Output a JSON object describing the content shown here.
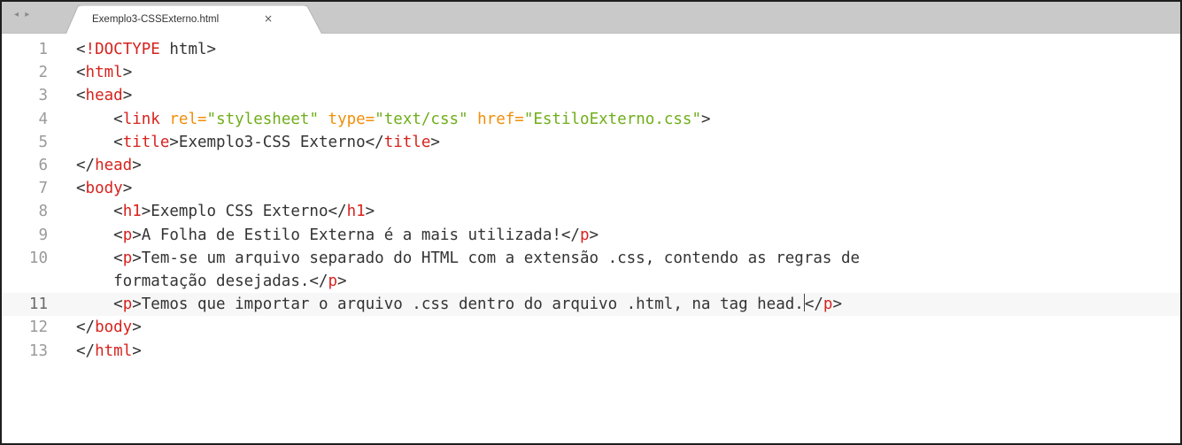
{
  "tabbar": {
    "nav_arrows": "◂ ▸",
    "active_tab": {
      "label": "Exemplo3-CSSExterno.html",
      "close": "×"
    }
  },
  "colors": {
    "tag": "#d6231e",
    "attribute": "#f18f0b",
    "string": "#6fae1a",
    "text": "#333333",
    "line_number": "#9a9a9a",
    "tabbar_bg": "#c9c9c9"
  },
  "editor": {
    "active_line": "11",
    "lines": [
      {
        "num": "1",
        "parts": [
          [
            "t",
            "<"
          ],
          [
            "k",
            "!DOCTYPE"
          ],
          [
            "t",
            " html>"
          ]
        ]
      },
      {
        "num": "2",
        "parts": [
          [
            "t",
            "<"
          ],
          [
            "k",
            "html"
          ],
          [
            "t",
            ">"
          ]
        ]
      },
      {
        "num": "3",
        "parts": [
          [
            "t",
            "<"
          ],
          [
            "k",
            "head"
          ],
          [
            "t",
            ">"
          ]
        ]
      },
      {
        "num": "4",
        "parts": [
          [
            "t",
            "    <"
          ],
          [
            "k",
            "link"
          ],
          [
            "t",
            " "
          ],
          [
            "a",
            "rel="
          ],
          [
            "s",
            "\"stylesheet\""
          ],
          [
            "t",
            " "
          ],
          [
            "a",
            "type="
          ],
          [
            "s",
            "\"text/css\""
          ],
          [
            "t",
            " "
          ],
          [
            "a",
            "href="
          ],
          [
            "s",
            "\"EstiloExterno.css\""
          ],
          [
            "t",
            ">"
          ]
        ]
      },
      {
        "num": "5",
        "parts": [
          [
            "t",
            "    <"
          ],
          [
            "k",
            "title"
          ],
          [
            "t",
            ">Exemplo3-CSS Externo</"
          ],
          [
            "k",
            "title"
          ],
          [
            "t",
            ">"
          ]
        ]
      },
      {
        "num": "6",
        "parts": [
          [
            "t",
            "</"
          ],
          [
            "k",
            "head"
          ],
          [
            "t",
            ">"
          ]
        ]
      },
      {
        "num": "7",
        "parts": [
          [
            "t",
            "<"
          ],
          [
            "k",
            "body"
          ],
          [
            "t",
            ">"
          ]
        ]
      },
      {
        "num": "8",
        "parts": [
          [
            "t",
            "    <"
          ],
          [
            "k",
            "h1"
          ],
          [
            "t",
            ">Exemplo CSS Externo</"
          ],
          [
            "k",
            "h1"
          ],
          [
            "t",
            ">"
          ]
        ]
      },
      {
        "num": "9",
        "parts": [
          [
            "t",
            "    <"
          ],
          [
            "k",
            "p"
          ],
          [
            "t",
            ">A Folha de Estilo Externa é a mais utilizada!</"
          ],
          [
            "k",
            "p"
          ],
          [
            "t",
            ">"
          ]
        ]
      },
      {
        "num": "10",
        "parts": [
          [
            "t",
            "    <"
          ],
          [
            "k",
            "p"
          ],
          [
            "t",
            ">Tem-se um arquivo separado do HTML com a extensão .css, contendo as regras de"
          ]
        ]
      },
      {
        "num": "",
        "parts": [
          [
            "t",
            "    formatação desejadas.</"
          ],
          [
            "k",
            "p"
          ],
          [
            "t",
            ">"
          ]
        ]
      },
      {
        "num": "11",
        "parts": [
          [
            "t",
            "    <"
          ],
          [
            "k",
            "p"
          ],
          [
            "t",
            ">Temos que importar o arquivo .css dentro do arquivo .html, na tag head."
          ],
          [
            "c",
            ""
          ],
          [
            "t",
            "</"
          ],
          [
            "k",
            "p"
          ],
          [
            "t",
            ">"
          ]
        ]
      },
      {
        "num": "12",
        "parts": [
          [
            "t",
            "</"
          ],
          [
            "k",
            "body"
          ],
          [
            "t",
            ">"
          ]
        ]
      },
      {
        "num": "13",
        "parts": [
          [
            "t",
            "</"
          ],
          [
            "k",
            "html"
          ],
          [
            "t",
            ">"
          ]
        ]
      }
    ]
  }
}
